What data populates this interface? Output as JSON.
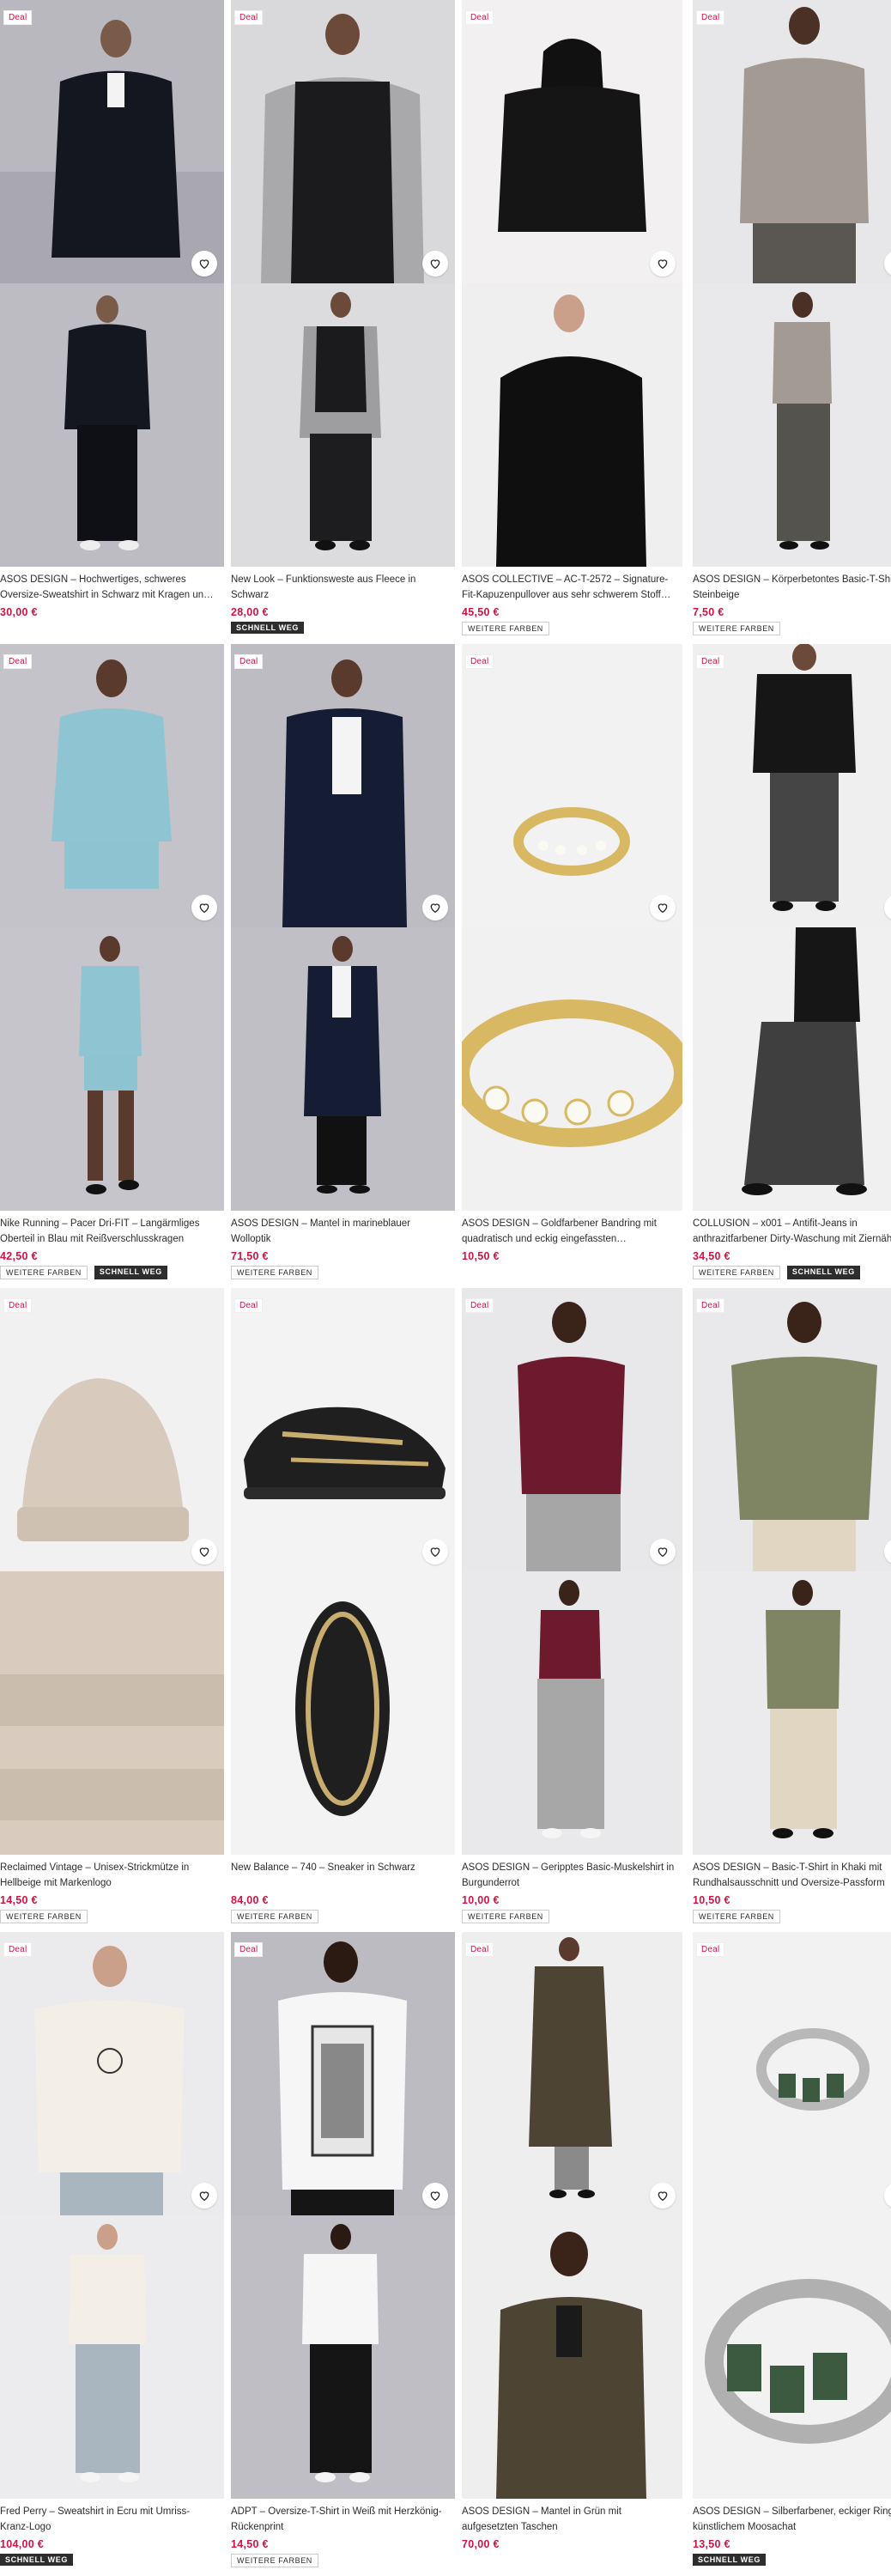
{
  "labels": {
    "deal": "Deal",
    "more_colors": "WEITERE FARBEN",
    "fast_delivery": "SCHNELL WEG"
  },
  "colors": {
    "price": "#d01345",
    "deal_text": "#d01345",
    "fast_badge_bg": "#2d2d2d"
  },
  "products": [
    {
      "title": "ASOS DESIGN – Hochwertiges, schweres Oversize-Sweatshirt in Schwarz mit Kragen und kurzem…",
      "price": "30,00 €",
      "deal": true,
      "more_colors": false,
      "fast": false
    },
    {
      "title": "New Look – Funktionsweste aus Fleece in Schwarz",
      "price": "28,00 €",
      "deal": true,
      "more_colors": false,
      "fast": true
    },
    {
      "title": "ASOS COLLECTIVE – AC-T-2572 – Signature-Fit-Kapuzenpullover aus sehr schwerem Stoff in…",
      "price": "45,50 €",
      "deal": true,
      "more_colors": true,
      "fast": false
    },
    {
      "title": "ASOS DESIGN – Körperbetontes Basic-T-Shirt in Steinbeige",
      "price": "7,50 €",
      "deal": true,
      "more_colors": true,
      "fast": false
    },
    {
      "title": "Nike Running – Pacer Dri-FIT – Langärmliges Oberteil in Blau mit Reißverschlusskragen",
      "price": "42,50 €",
      "deal": true,
      "more_colors": true,
      "fast": true
    },
    {
      "title": "ASOS DESIGN – Mantel in marineblauer Wolloptik",
      "price": "71,50 €",
      "deal": true,
      "more_colors": true,
      "fast": false
    },
    {
      "title": "ASOS DESIGN – Goldfarbener Bandring mit quadratisch und eckig eingefassten Strasssteinen",
      "price": "10,50 €",
      "deal": true,
      "more_colors": false,
      "fast": false
    },
    {
      "title": "COLLUSION – x001 – Antifit-Jeans in anthrazitfarbener Dirty-Waschung mit Ziernähten",
      "price": "34,50 €",
      "deal": true,
      "more_colors": true,
      "fast": true
    },
    {
      "title": "Reclaimed Vintage – Unisex-Strickmütze in Hellbeige mit Markenlogo",
      "price": "14,50 €",
      "deal": true,
      "more_colors": true,
      "fast": false
    },
    {
      "title": "New Balance – 740 – Sneaker in Schwarz",
      "price": "84,00 €",
      "deal": true,
      "more_colors": true,
      "fast": false
    },
    {
      "title": "ASOS DESIGN – Geripptes Basic-Muskelshirt in Burgunderrot",
      "price": "10,00 €",
      "deal": true,
      "more_colors": true,
      "fast": false
    },
    {
      "title": "ASOS DESIGN – Basic-T-Shirt in Khaki mit Rundhalsausschnitt und Oversize-Passform",
      "price": "10,50 €",
      "deal": true,
      "more_colors": true,
      "fast": false
    },
    {
      "title": "Fred Perry – Sweatshirt in Ecru mit Umriss-Kranz-Logo",
      "price": "104,00 €",
      "deal": true,
      "more_colors": false,
      "fast": true
    },
    {
      "title": "ADPT – Oversize-T-Shirt in Weiß mit Herzkönig-Rückenprint",
      "price": "14,50 €",
      "deal": true,
      "more_colors": true,
      "fast": false
    },
    {
      "title": "ASOS DESIGN – Mantel in Grün mit aufgesetzten Taschen",
      "price": "70,00 €",
      "deal": true,
      "more_colors": false,
      "fast": false
    },
    {
      "title": "ASOS DESIGN – Silberfarbener, eckiger Ring mit künstlichem Moosachat",
      "price": "13,50 €",
      "deal": true,
      "more_colors": false,
      "fast": true
    }
  ]
}
